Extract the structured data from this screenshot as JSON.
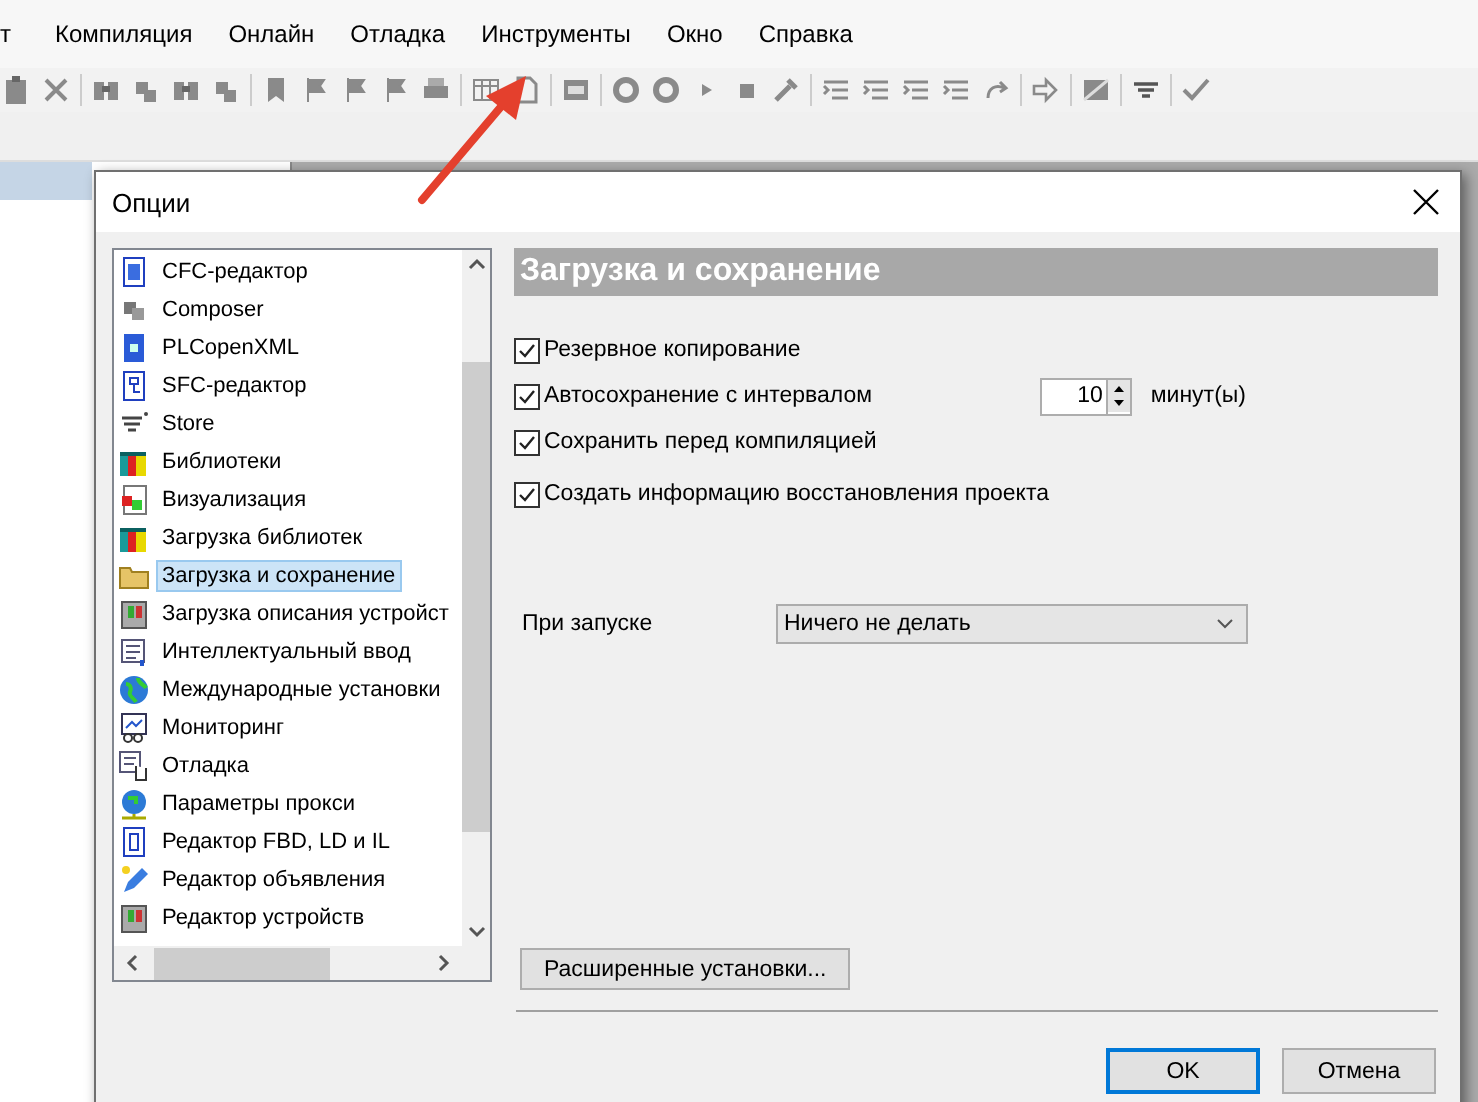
{
  "menu": [
    {
      "label": "т"
    },
    {
      "label": "Компиляция"
    },
    {
      "label": "Онлайн"
    },
    {
      "label": "Отладка"
    },
    {
      "label": "Инструменты"
    },
    {
      "label": "Окно"
    },
    {
      "label": "Справка"
    }
  ],
  "dialog": {
    "title": "Опции",
    "categories": [
      {
        "label": "CFC-редактор",
        "selected": false
      },
      {
        "label": "Composer",
        "selected": false
      },
      {
        "label": "PLCopenXML",
        "selected": false
      },
      {
        "label": "SFC-редактор",
        "selected": false
      },
      {
        "label": "Store",
        "selected": false
      },
      {
        "label": "Библиотеки",
        "selected": false
      },
      {
        "label": "Визуализация",
        "selected": false
      },
      {
        "label": "Загрузка библиотек",
        "selected": false
      },
      {
        "label": "Загрузка и сохранение",
        "selected": true
      },
      {
        "label": "Загрузка описания устройст",
        "selected": false
      },
      {
        "label": "Интеллектуальный ввод",
        "selected": false
      },
      {
        "label": "Международные установки",
        "selected": false
      },
      {
        "label": "Мониторинг",
        "selected": false
      },
      {
        "label": "Отладка",
        "selected": false
      },
      {
        "label": "Параметры прокси",
        "selected": false
      },
      {
        "label": "Редактор FBD, LD и IL",
        "selected": false
      },
      {
        "label": "Редактор объявления",
        "selected": false
      },
      {
        "label": "Редактор устройств",
        "selected": false
      }
    ],
    "page_title": "Загрузка и сохранение",
    "options": [
      {
        "label": "Резервное копирование",
        "checked": true
      },
      {
        "label": "Автосохранение с интервалом",
        "checked": true
      },
      {
        "label": "Сохранить перед компиляцией",
        "checked": true
      },
      {
        "label": "Создать информацию восстановления проекта",
        "checked": true
      }
    ],
    "interval": {
      "value": "10",
      "unit": "минут(ы)"
    },
    "startup": {
      "label": "При запуске",
      "value": "Ничего не делать"
    },
    "advanced_button": "Расширенные установки...",
    "buttons": [
      {
        "label": "OK",
        "kind": "default"
      },
      {
        "label": "Отмена",
        "kind": "normal"
      }
    ]
  }
}
